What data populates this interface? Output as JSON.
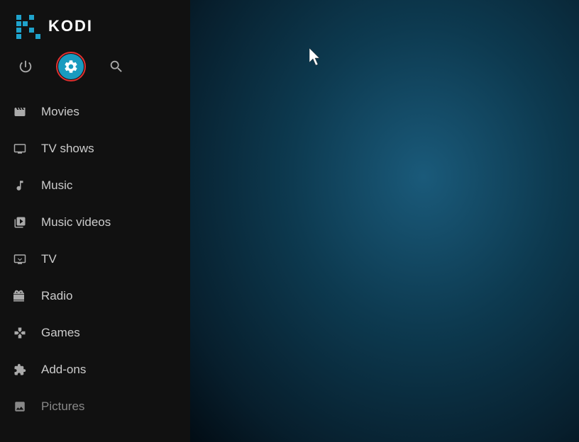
{
  "app": {
    "title": "KODI"
  },
  "topIcons": {
    "power_label": "Power",
    "settings_label": "Settings",
    "search_label": "Search"
  },
  "nav": {
    "items": [
      {
        "id": "movies",
        "label": "Movies",
        "icon": "movies"
      },
      {
        "id": "tvshows",
        "label": "TV shows",
        "icon": "tv"
      },
      {
        "id": "music",
        "label": "Music",
        "icon": "music"
      },
      {
        "id": "musicvideos",
        "label": "Music videos",
        "icon": "musicvideos"
      },
      {
        "id": "tv",
        "label": "TV",
        "icon": "livetv"
      },
      {
        "id": "radio",
        "label": "Radio",
        "icon": "radio"
      },
      {
        "id": "games",
        "label": "Games",
        "icon": "games"
      },
      {
        "id": "addons",
        "label": "Add-ons",
        "icon": "addons"
      },
      {
        "id": "pictures",
        "label": "Pictures",
        "icon": "pictures",
        "dimmed": true
      }
    ]
  },
  "colors": {
    "settings_active": "#1a9bbf",
    "highlight_border": "#e03030",
    "sidebar_bg": "#111111"
  }
}
